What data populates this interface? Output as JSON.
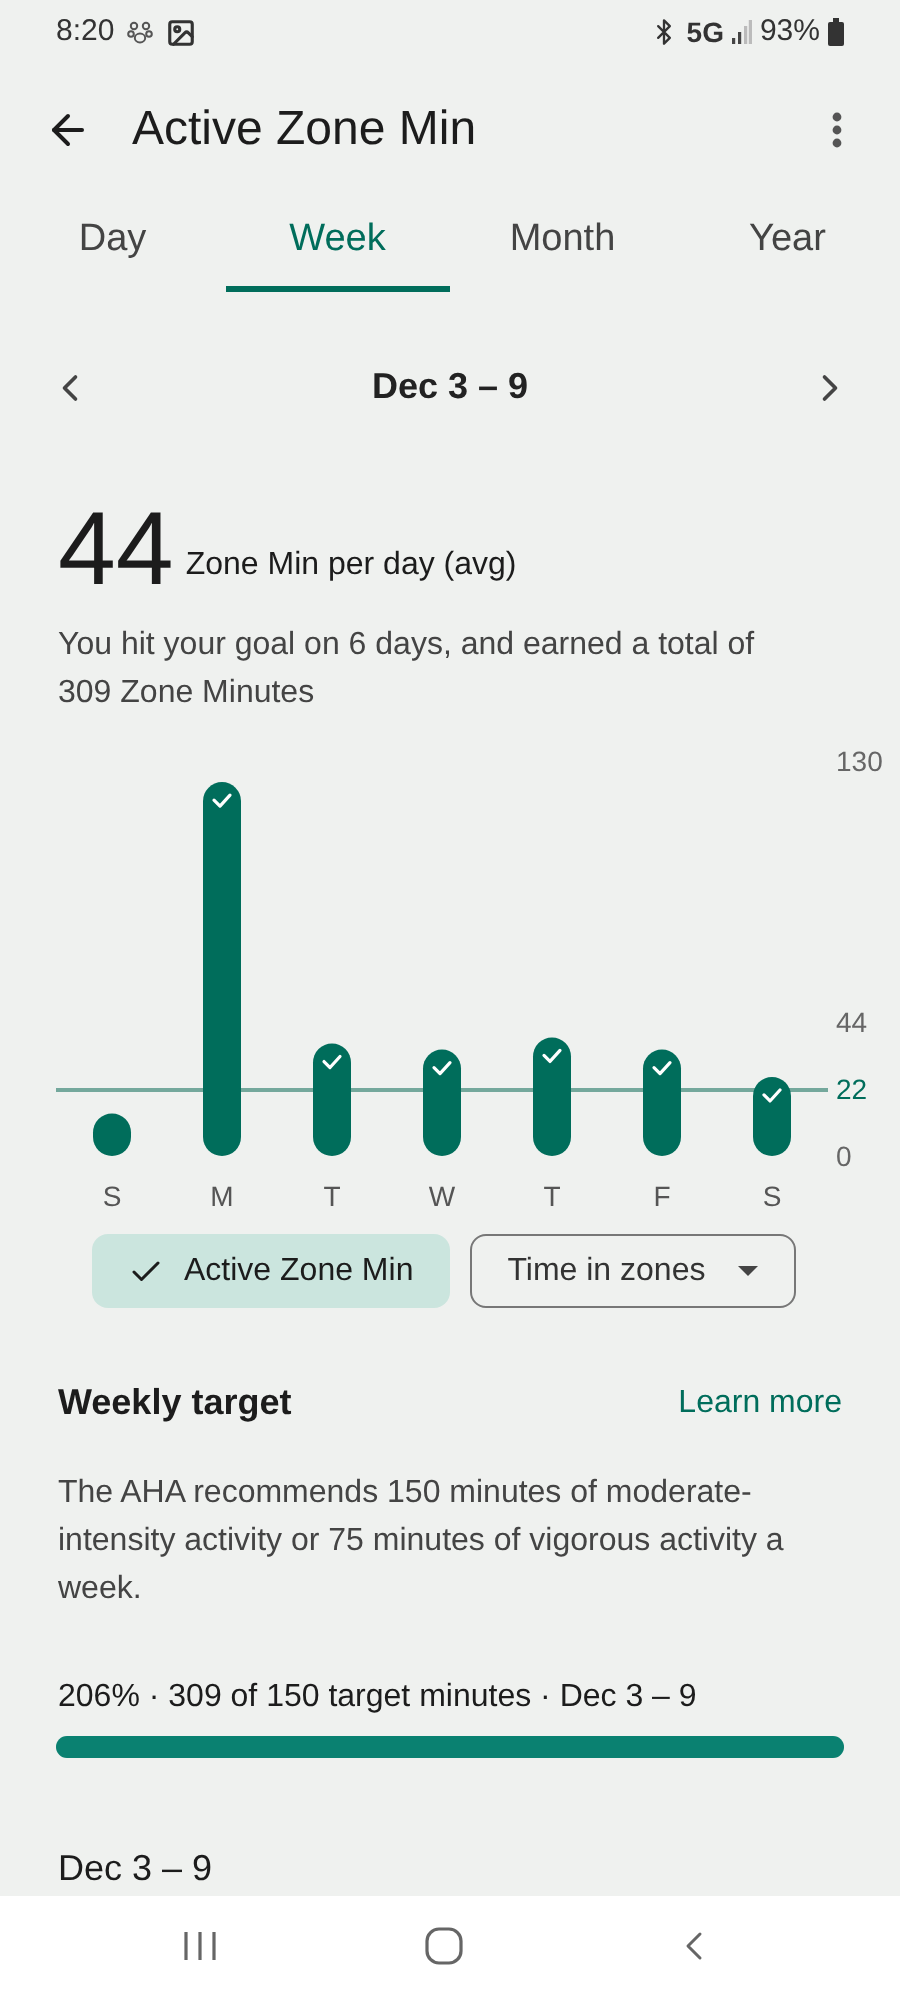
{
  "status_bar": {
    "time": "8:20",
    "network": "5G",
    "battery": "93%"
  },
  "header": {
    "title": "Active Zone Min"
  },
  "tabs": [
    {
      "label": "Day",
      "selected": false
    },
    {
      "label": "Week",
      "selected": true
    },
    {
      "label": "Month",
      "selected": false
    },
    {
      "label": "Year",
      "selected": false
    }
  ],
  "date_range": "Dec 3 – 9",
  "summary": {
    "value": "44",
    "unit": "Zone Min per day (avg)",
    "description": "You hit your goal on 6 days, and earned a total of 309 Zone Minutes"
  },
  "chart": {
    "chart_data": {
      "type": "bar",
      "categories": [
        "S",
        "M",
        "T",
        "W",
        "T",
        "F",
        "S"
      ],
      "series": [
        {
          "color": "#006d5b",
          "values": [
            14,
            123,
            37,
            35,
            39,
            35,
            26
          ]
        }
      ],
      "yticks": [
        0,
        22,
        44,
        130
      ],
      "ylim": [
        0,
        130
      ]
    },
    "goal_line": {
      "at_tick": "22"
    }
  },
  "chips": [
    {
      "label": "Active Zone Min",
      "kind": "toggle",
      "selected": true
    },
    {
      "label": "Time in zones",
      "kind": "dropdown",
      "selected": false
    }
  ],
  "weekly_target": {
    "title": "Weekly target",
    "link": "Learn more",
    "description": "The AHA recommends 150 minutes of moderate-intensity activity or 75 minutes of vigorous activity a week.",
    "progress_text": "206% · 309 of 150 target minutes · Dec 3 – 9",
    "level": 1
  },
  "next_section": {
    "title": "Dec 3 – 9"
  }
}
